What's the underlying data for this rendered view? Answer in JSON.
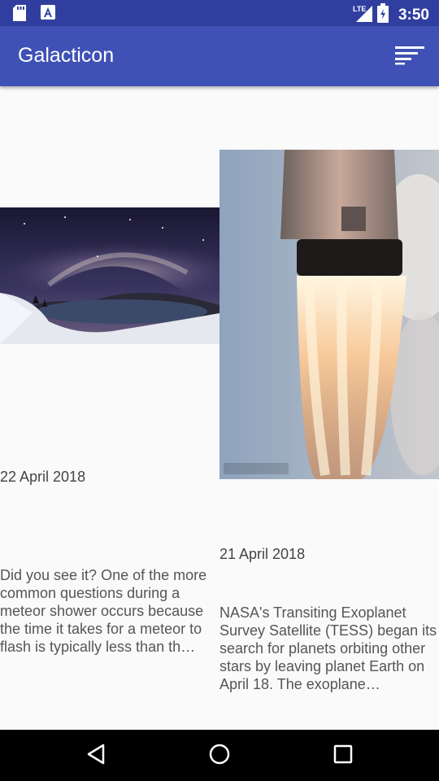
{
  "status_bar": {
    "time": "3:50",
    "network": "LTE",
    "icons": [
      "sd-card-icon",
      "a-notification-icon",
      "lte-signal-icon",
      "battery-icon"
    ]
  },
  "app_bar": {
    "title": "Galacticon",
    "sort_icon": "sort-icon"
  },
  "posts": [
    {
      "image": "milky-way-lake-photo",
      "date": "22 April 2018",
      "description": "Did you see it?  One of the more common questions during a meteor shower occurs because the time it takes for a meteor to flash is typically less than th…"
    },
    {
      "image": "rocket-launch-photo",
      "date": "21 April 2018",
      "description": "NASA's Transiting Exoplanet Survey Satellite (TESS) began its search for planets orbiting other stars by leaving planet Earth on April 18. The exoplane…"
    }
  ],
  "nav_bar": {
    "buttons": [
      "back-icon",
      "home-icon",
      "recents-icon"
    ]
  },
  "colors": {
    "primary": "#3F51B5",
    "primary_dark": "#303F9F",
    "background": "#FAFAFA"
  }
}
